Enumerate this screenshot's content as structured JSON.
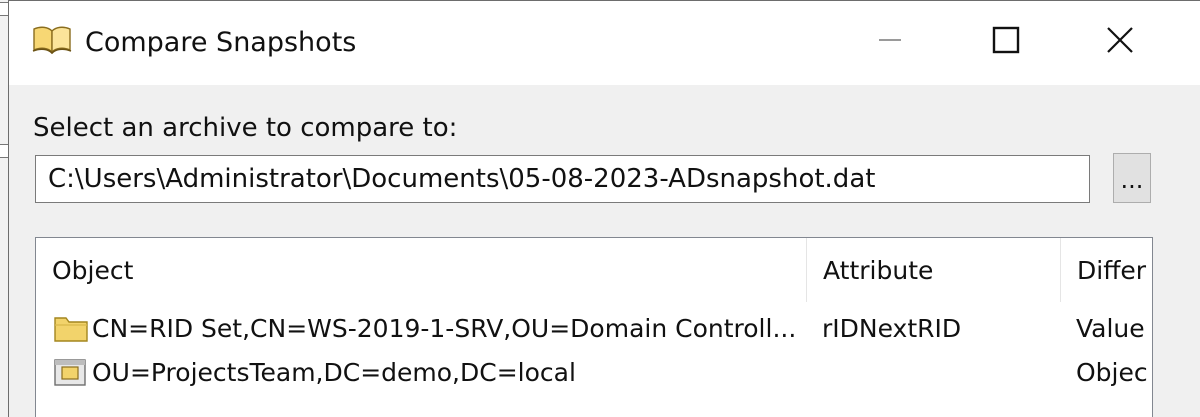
{
  "window": {
    "title": "Compare Snapshots",
    "app_icon": "open-book-icon",
    "controls": {
      "minimize_icon": "minimize-icon",
      "maximize_icon": "maximize-icon",
      "close_icon": "close-icon"
    }
  },
  "archive": {
    "prompt": "Select an archive to compare to:",
    "path": "C:\\Users\\Administrator\\Documents\\05-08-2023-ADsnapshot.dat",
    "browse_label": "..."
  },
  "results": {
    "columns": [
      "Object",
      "Attribute",
      "Differ"
    ],
    "rows": [
      {
        "icon": "folder-icon",
        "object": "CN=RID Set,CN=WS-2019-1-SRV,OU=Domain Controll...",
        "attribute": "rIDNextRID",
        "difference": "Value"
      },
      {
        "icon": "organizational-unit-icon",
        "object": "OU=ProjectsTeam,DC=demo,DC=local",
        "attribute": "",
        "difference": "Objec"
      }
    ]
  },
  "colors": {
    "titlebar": "#ffffff",
    "client": "#f0f0f0",
    "folder": "#f2d36b"
  }
}
